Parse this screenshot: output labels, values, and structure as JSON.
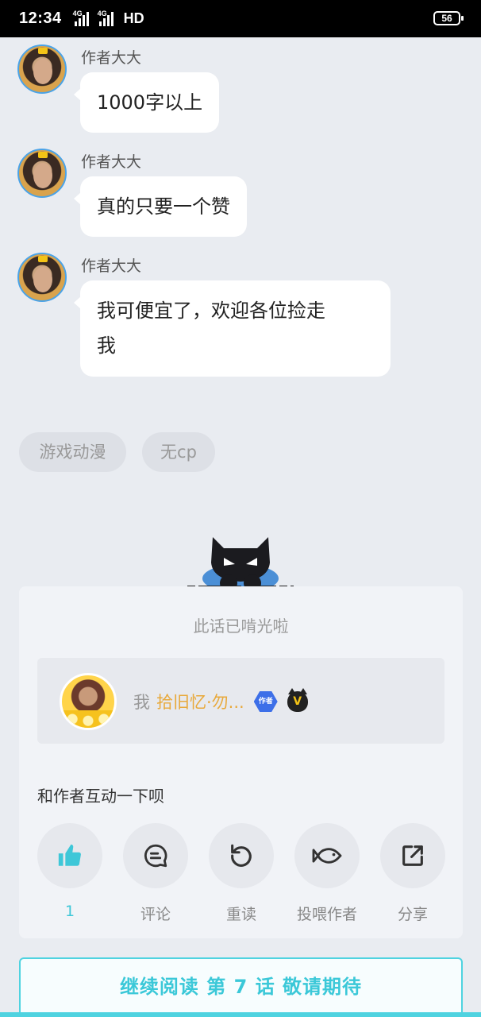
{
  "status_bar": {
    "time": "12:34",
    "network1": "4G",
    "network2": "4G",
    "hd": "HD",
    "battery": "56"
  },
  "messages": [
    {
      "author": "作者大大",
      "text": "1000字以上"
    },
    {
      "author": "作者大大",
      "text": "真的只要一个赞"
    },
    {
      "author": "作者大大",
      "text_line1": "我可便宜了，欢迎各位捡走",
      "text_line2": "我"
    }
  ],
  "tags": [
    "游戏动漫",
    "无cp"
  ],
  "card": {
    "finished_text": "此话已啃光啦",
    "author_prefix": "我",
    "author_name": "拾旧忆·勿...",
    "author_badge": "作者",
    "vip_badge": "V",
    "interact_title": "和作者互动一下呗",
    "actions": [
      {
        "label": "1",
        "icon": "thumbs-up-icon"
      },
      {
        "label": "评论",
        "icon": "comment-icon"
      },
      {
        "label": "重读",
        "icon": "reread-icon"
      },
      {
        "label": "投喂作者",
        "icon": "fish-icon"
      },
      {
        "label": "分享",
        "icon": "share-icon"
      }
    ]
  },
  "continue_button": "继续阅读 第 7 话 敬请期待",
  "colors": {
    "accent": "#3ec7d8",
    "author_name": "#e8a93b",
    "avatar_border": "#4aa3e8",
    "background": "#e9ecf1"
  }
}
